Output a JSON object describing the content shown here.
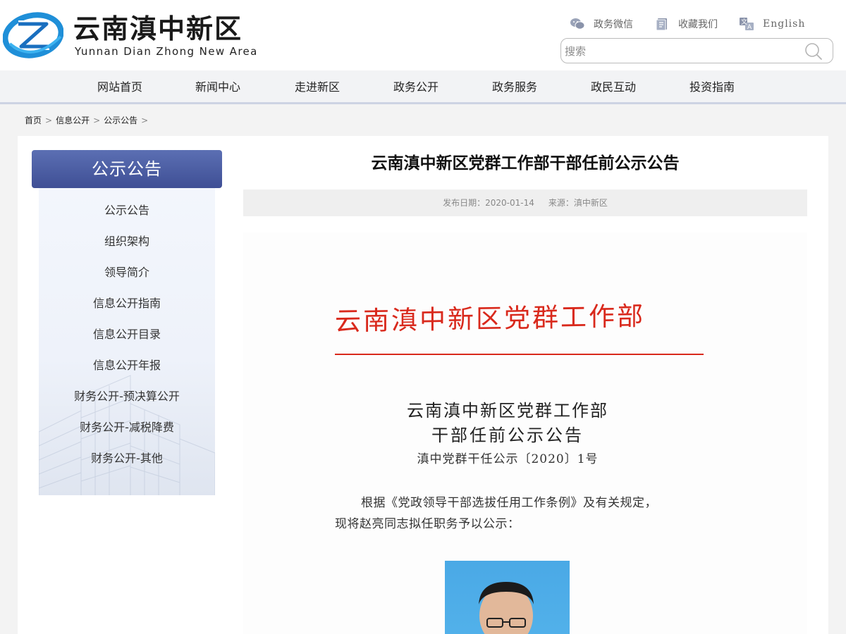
{
  "header": {
    "logo_cn": "云南滇中新区",
    "logo_en": "Yunnan Dian Zhong New Area",
    "links": [
      {
        "label": "政务微信",
        "icon": "wechat-icon"
      },
      {
        "label": "收藏我们",
        "icon": "bookmark-icon"
      },
      {
        "label": "English",
        "icon": "translate-icon"
      }
    ],
    "search": {
      "placeholder": "搜索",
      "icon": "search-icon"
    }
  },
  "nav": {
    "items": [
      "网站首页",
      "新闻中心",
      "走进新区",
      "政务公开",
      "政务服务",
      "政民互动",
      "投资指南"
    ]
  },
  "breadcrumb": [
    "首页",
    "信息公开",
    "公示公告"
  ],
  "sidebar": {
    "title": "公示公告",
    "items": [
      "公示公告",
      "组织架构",
      "领导简介",
      "信息公开指南",
      "信息公开目录",
      "信息公开年报",
      "财务公开-预决算公开",
      "财务公开-减税降费",
      "财务公开-其他"
    ]
  },
  "article": {
    "title": "云南滇中新区党群工作部干部任前公示公告",
    "date_label": "发布日期：",
    "date": "2020-01-14",
    "source_label": "来源：",
    "source": "滇中新区",
    "doc": {
      "header": "云南滇中新区党群工作部",
      "title_line1": "云南滇中新区党群工作部",
      "title_line2": "干部任前公示公告",
      "number": "滇中党群干任公示〔2020〕1号",
      "para1": "根据《党政领导干部选拔任用工作条例》及有关规定，",
      "para2": "现将赵亮同志拟任职务予以公示："
    }
  },
  "colors": {
    "logo_blue": "#1f8fd8",
    "sidebar_head": "#4a5ca3",
    "doc_red": "#d9291c"
  }
}
